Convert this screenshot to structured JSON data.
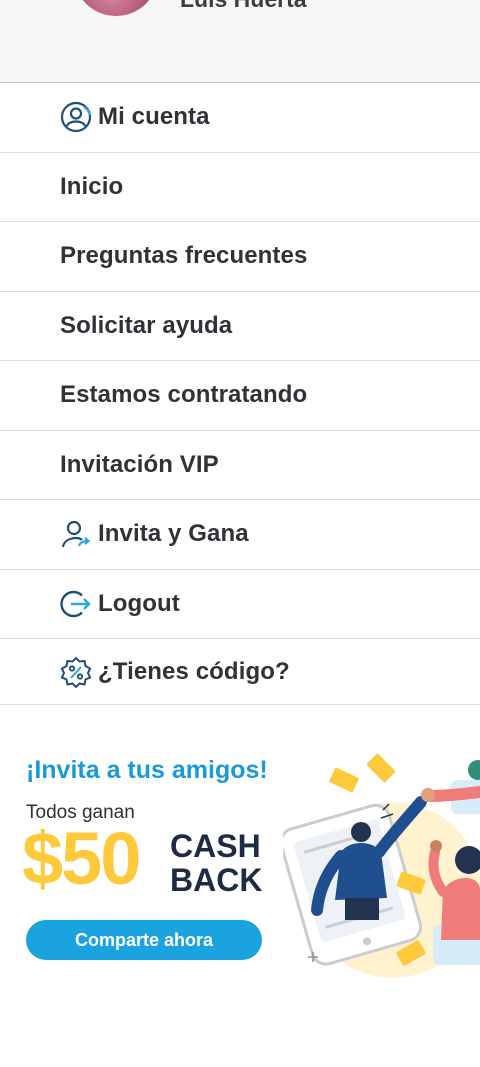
{
  "header": {
    "user_name": "Luis Huerta"
  },
  "menu": {
    "items": [
      {
        "label": "Mi cuenta",
        "icon": "user-circle-icon"
      },
      {
        "label": "Inicio",
        "icon": ""
      },
      {
        "label": "Preguntas frecuentes",
        "icon": ""
      },
      {
        "label": "Solicitar ayuda",
        "icon": ""
      },
      {
        "label": "Estamos contratando",
        "icon": ""
      },
      {
        "label": "Invitación VIP",
        "icon": ""
      },
      {
        "label": "Invita y Gana",
        "icon": "user-share-icon"
      },
      {
        "label": "Logout",
        "icon": "logout-icon"
      },
      {
        "label": "¿Tienes código?",
        "icon": "discount-badge-icon"
      }
    ]
  },
  "promo": {
    "title": "¡Invita a tus amigos!",
    "subtitle": "Todos ganan",
    "amount": "$50",
    "cash": "CASH",
    "back": "BACK",
    "button_label": "Comparte ahora",
    "colors": {
      "title": "#1a9ad6",
      "amount": "#ffc93c",
      "button": "#1ba3e0",
      "icon": "#1f4e79"
    }
  }
}
